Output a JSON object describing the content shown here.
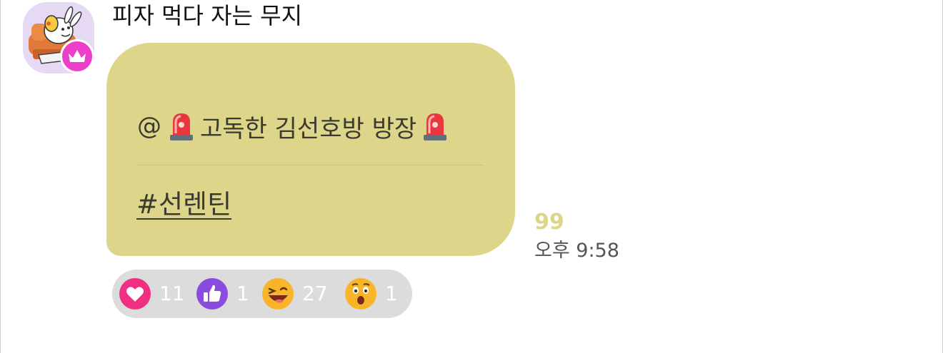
{
  "message": {
    "sender": "피자 먹다 자는 무지",
    "mention_prefix": "@",
    "mention_text": "고독한 김선호방 방장",
    "hashtag": "#선렌틴",
    "read_count": "99",
    "time": "오후 9:58"
  },
  "reactions": [
    {
      "icon": "heart-icon",
      "count": "11",
      "color": "#f02f83"
    },
    {
      "icon": "thumbs-up-icon",
      "count": "1",
      "color": "#8a4be0"
    },
    {
      "icon": "laughing-face-icon",
      "count": "27",
      "color": "#f8b52a"
    },
    {
      "icon": "surprised-face-icon",
      "count": "1",
      "color": "#f8b52a"
    }
  ],
  "colors": {
    "bubble": "#ddd68a",
    "read_count": "#ddd68a",
    "crown_badge": "#ee3fcb",
    "avatar_bg": "#e6d9f3"
  }
}
